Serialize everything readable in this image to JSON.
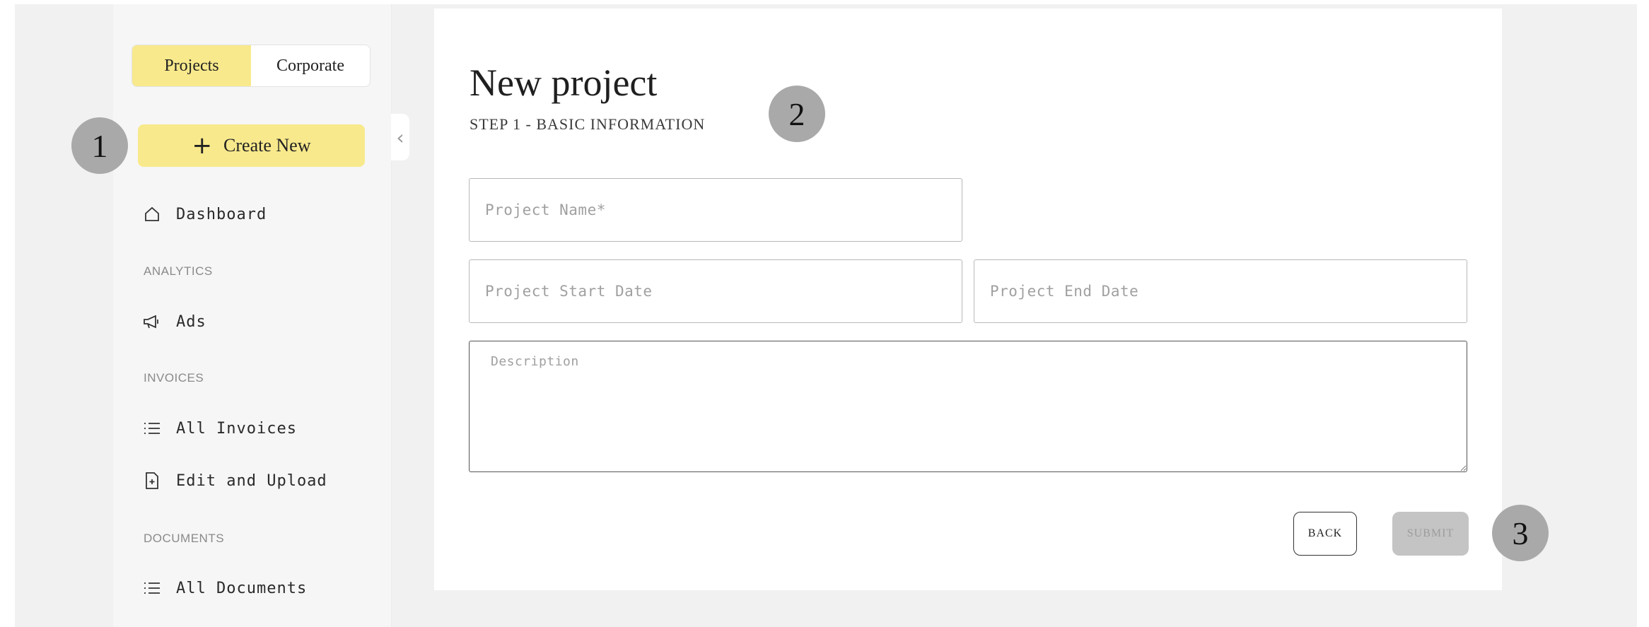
{
  "sidebar": {
    "toggle": [
      {
        "label": "Projects",
        "active": true
      },
      {
        "label": "Corporate",
        "active": false
      }
    ],
    "create_new_label": "Create New",
    "dashboard_label": "Dashboard",
    "sections": {
      "analytics": "ANALYTICS",
      "invoices": "INVOICES",
      "documents": "DOCUMENTS"
    },
    "items": {
      "ads": "Ads",
      "all_invoices": "All Invoices",
      "edit_upload": "Edit and Upload",
      "all_documents": "All Documents"
    },
    "collapse_icon": "chevron-left-icon"
  },
  "main": {
    "title": "New project",
    "subtitle": "STEP 1 - BASIC INFORMATION",
    "fields": {
      "project_name_placeholder": "Project Name*",
      "start_date_placeholder": "Project Start Date",
      "end_date_placeholder": "Project End Date",
      "description_placeholder": "Description"
    },
    "back_label": "BACK",
    "submit_label": "SUBMIT"
  },
  "markers": [
    "1",
    "2",
    "3"
  ],
  "colors": {
    "accent_yellow": "#f8e98c",
    "marker_gray": "#a9a9a9",
    "disabled_gray": "#c4c4c4"
  }
}
